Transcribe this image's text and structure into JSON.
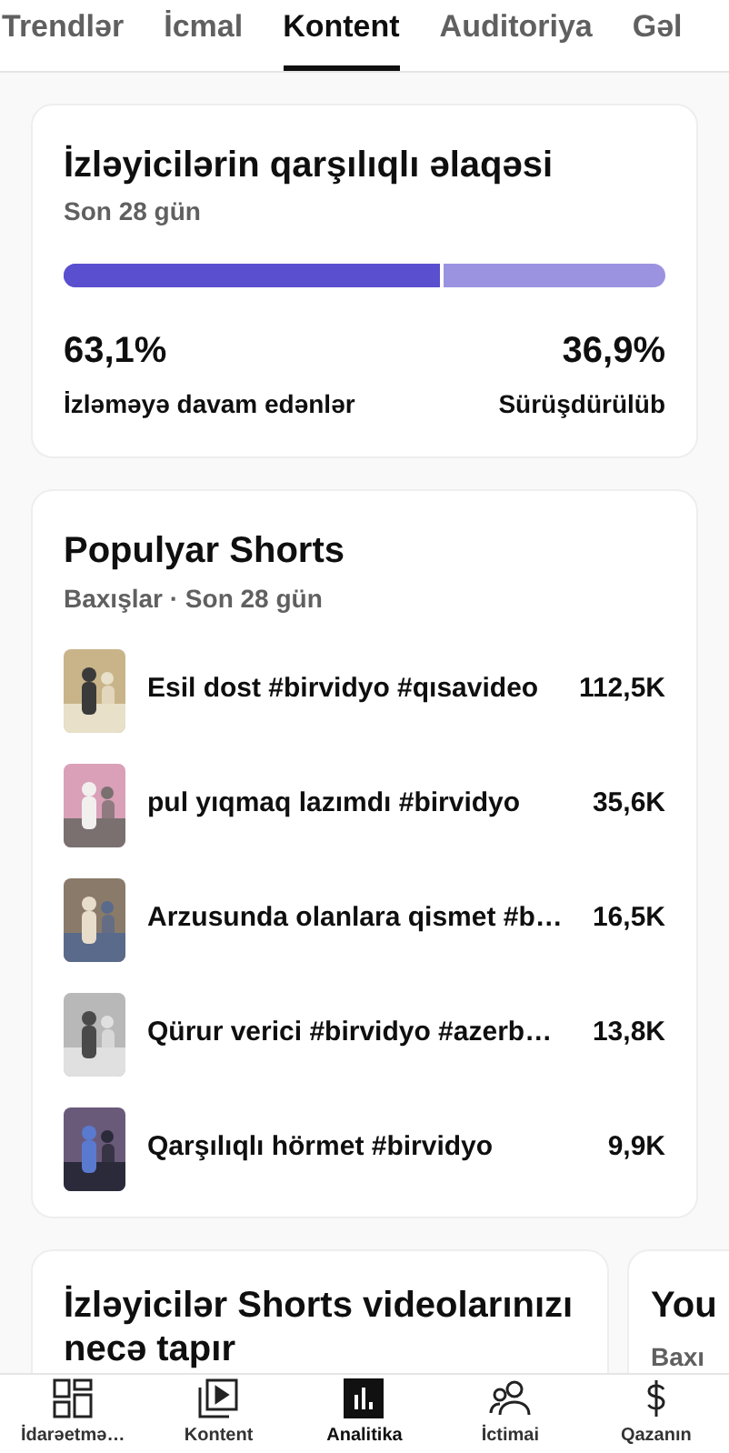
{
  "tabs": [
    {
      "label": "Trendlər",
      "selected": false
    },
    {
      "label": "İcmal",
      "selected": false
    },
    {
      "label": "Kontent",
      "selected": true
    },
    {
      "label": "Auditoriya",
      "selected": false
    },
    {
      "label": "Gəl",
      "selected": false
    }
  ],
  "engagement_card": {
    "title": "İzləyicilərin qarşılıqlı əlaqəsi",
    "subtitle": "Son 28 gün",
    "level": 0.631,
    "left_value": "63,1%",
    "left_label": "İzləməyə davam edənlər",
    "right_value": "36,9%",
    "right_label": "Sürüşdürülüb"
  },
  "popular_card": {
    "title": "Populyar Shorts",
    "subtitle": "Baxışlar · Son 28 gün",
    "rows": [
      {
        "title": "Esil dost #birvidyo #qısavideo",
        "views": "112,5K"
      },
      {
        "title": "pul yıqmaq lazımdı #birvidyo",
        "views": "35,6K"
      },
      {
        "title": "Arzusunda olanlara qismet #b…",
        "views": "16,5K"
      },
      {
        "title": "Qürur verici #birvidyo #azerb…",
        "views": "13,8K"
      },
      {
        "title": "Qarşılıqlı hörmet #birvidyo",
        "views": "9,9K"
      }
    ]
  },
  "discovery_card": {
    "title": "İzləyicilər Shorts videolarınızı necə tapır"
  },
  "next_card": {
    "title": "You",
    "subtitle": "Baxı"
  },
  "bottom_nav": [
    {
      "label": "İdarəetmə…",
      "selected": false
    },
    {
      "label": "Kontent",
      "selected": false
    },
    {
      "label": "Analitika",
      "selected": true
    },
    {
      "label": "İctimai",
      "selected": false
    },
    {
      "label": "Qazanın",
      "selected": false
    }
  ]
}
